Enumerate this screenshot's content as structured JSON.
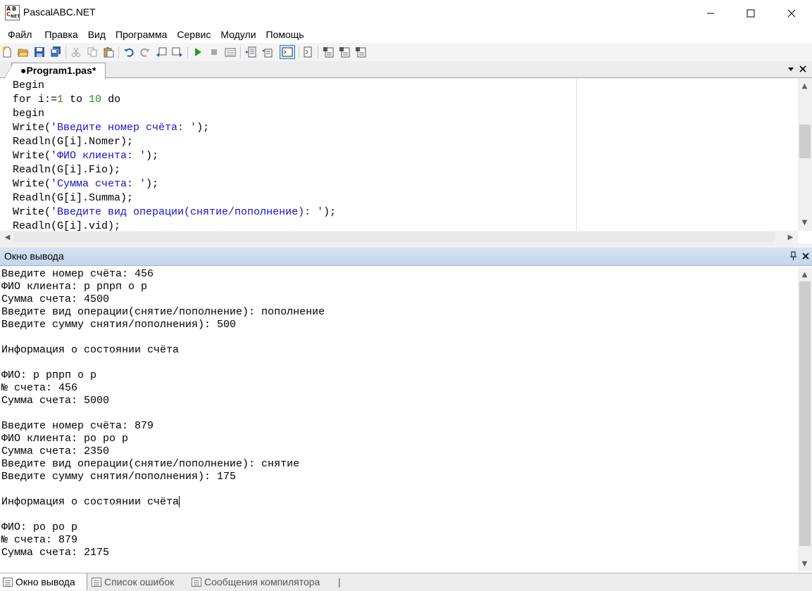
{
  "window": {
    "title": "PascalABC.NET",
    "icon_letters": [
      "A",
      "B",
      "C",
      "NET"
    ]
  },
  "menu": {
    "items": [
      "Файл",
      "Правка",
      "Вид",
      "Программа",
      "Сервис",
      "Модули",
      "Помощь"
    ]
  },
  "toolbar": {
    "buttons": [
      "new-file-icon",
      "open-icon",
      "save-icon",
      "save-all-icon",
      "cut-icon",
      "copy-icon",
      "paste-icon",
      "undo-icon",
      "redo-icon",
      "unindent-icon",
      "indent-icon",
      "run-icon",
      "stop-icon",
      "compile-icon",
      "step-into-icon",
      "step-over-icon",
      "output-window-icon",
      "debug-icon",
      "form-designer-icon",
      "watch-icon",
      "locals-icon"
    ]
  },
  "editor": {
    "tab_label": "●Program1.pas*",
    "lines": [
      [
        {
          "t": "Begin",
          "c": "kw"
        }
      ],
      [
        {
          "t": "for i:=",
          "c": "kw"
        },
        {
          "t": "1",
          "c": "num"
        },
        {
          "t": " to ",
          "c": "kw"
        },
        {
          "t": "10",
          "c": "num"
        },
        {
          "t": " do",
          "c": "kw"
        }
      ],
      [
        {
          "t": "begin",
          "c": "kw"
        }
      ],
      [
        {
          "t": "Write(",
          "c": "kw"
        },
        {
          "t": "'Введите номер счёта: '",
          "c": "str"
        },
        {
          "t": ");",
          "c": "kw"
        }
      ],
      [
        {
          "t": "Readln(G[i].Nomer);",
          "c": "kw"
        }
      ],
      [
        {
          "t": "Write(",
          "c": "kw"
        },
        {
          "t": "'ФИО клиента: '",
          "c": "str"
        },
        {
          "t": ");",
          "c": "kw"
        }
      ],
      [
        {
          "t": "Readln(G[i].Fio);",
          "c": "kw"
        }
      ],
      [
        {
          "t": "Write(",
          "c": "kw"
        },
        {
          "t": "'Сумма счета: '",
          "c": "str"
        },
        {
          "t": ");",
          "c": "kw"
        }
      ],
      [
        {
          "t": "Readln(G[i].Summa);",
          "c": "kw"
        }
      ],
      [
        {
          "t": "Write(",
          "c": "kw"
        },
        {
          "t": "'Введите вид операции(снятие/пополнение): '",
          "c": "str"
        },
        {
          "t": ");",
          "c": "kw"
        }
      ],
      [
        {
          "t": "Readln(G[i].vid);",
          "c": "kw"
        }
      ]
    ]
  },
  "output": {
    "title": "Окно вывода",
    "lines": [
      "Введите номер счёта: 456",
      "ФИО клиента: р рпрп о р",
      "Сумма счета: 4500",
      "Введите вид операции(снятие/пополнение): пополнение",
      "Введите сумму снятия/пополнения): 500",
      "",
      "Информация о состоянии счёта",
      "",
      "ФИО: р рпрп о р",
      "№ счета: 456",
      "Сумма счета: 5000",
      "",
      "Введите номер счёта: 879",
      "ФИО клиента: ро ро р",
      "Сумма счета: 2350",
      "Введите вид операции(снятие/пополнение): снятие",
      "Введите сумму снятия/пополнения): 175",
      "",
      "Информация о состоянии счёта",
      "",
      "ФИО: ро ро р",
      "№ счета: 879",
      "Сумма счета: 2175"
    ],
    "caret_line": 18
  },
  "bottom_tabs": {
    "items": [
      "Окно вывода",
      "Список ошибок",
      "Сообщения компилятора"
    ],
    "active": "Окно вывода",
    "trailing_separator": "|"
  },
  "colors": {
    "string": "#1515c8",
    "number": "#2a8c2a",
    "output_header": "#c9dbf0"
  }
}
